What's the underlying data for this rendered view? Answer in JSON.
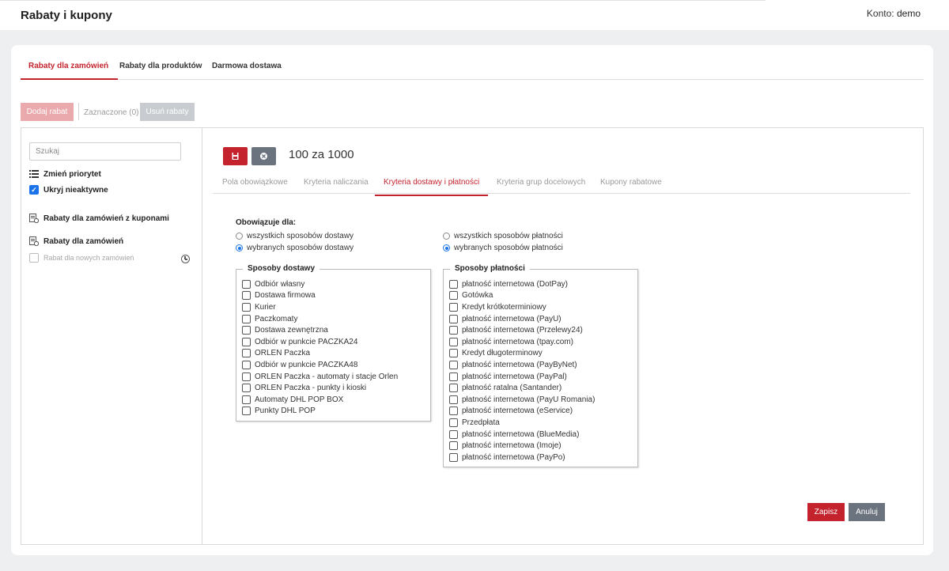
{
  "header": {
    "title": "Rabaty i kupony",
    "account_label": "Konto:",
    "account_name": "demo"
  },
  "main_tabs": [
    {
      "label": "Rabaty dla zamówień",
      "active": true
    },
    {
      "label": "Rabaty dla produktów",
      "active": false
    },
    {
      "label": "Darmowa dostawa",
      "active": false
    }
  ],
  "toolbar": {
    "add_label": "Dodaj rabat",
    "selected_label": "Zaznaczone (0)",
    "delete_label": "Usuń rabaty"
  },
  "sidebar": {
    "search_placeholder": "Szukaj",
    "change_priority": "Zmień priorytet",
    "hide_inactive": "Ukryj nieaktywne",
    "hide_inactive_checked": true,
    "group_coupons": "Rabaty dla zamówień z kuponami",
    "group_orders": "Rabaty dla zamówień",
    "items": [
      {
        "label": "Rabat dla nowych zamówień",
        "checked": false
      }
    ]
  },
  "editor": {
    "title": "100 za 1000",
    "save_icon": "floppy-icon",
    "close_icon": "x-circle-icon",
    "tabs": [
      {
        "label": "Pola obowiązkowe",
        "active": false
      },
      {
        "label": "Kryteria naliczania",
        "active": false
      },
      {
        "label": "Kryteria dostawy i płatności",
        "active": true
      },
      {
        "label": "Kryteria grup docelowych",
        "active": false
      },
      {
        "label": "Kupony rabatowe",
        "active": false
      }
    ],
    "applies_label": "Obowiązuje dla:",
    "shipping_radio": [
      {
        "label": "wszystkich sposobów dostawy",
        "selected": false
      },
      {
        "label": "wybranych sposobów dostawy",
        "selected": true
      }
    ],
    "payment_radio": [
      {
        "label": "wszystkich sposobów płatności",
        "selected": false
      },
      {
        "label": "wybranych sposobów płatności",
        "selected": true
      }
    ],
    "shipping_legend": "Sposoby dostawy",
    "shipping_methods": [
      "Odbiór własny",
      "Dostawa firmowa",
      "Kurier",
      "Paczkomaty",
      "Dostawa zewnętrzna",
      "Odbiór w punkcie PACZKA24",
      "ORLEN Paczka",
      "Odbiór w punkcie PACZKA48",
      "ORLEN Paczka - automaty i stacje Orlen",
      "ORLEN Paczka - punkty i kioski",
      "Automaty DHL POP BOX",
      "Punkty DHL POP"
    ],
    "payment_legend": "Sposoby płatności",
    "payment_methods": [
      "płatność internetowa (DotPay)",
      "Gotówka",
      "Kredyt krótkoterminiowy",
      "płatność internetowa (PayU)",
      "płatność internetowa (Przelewy24)",
      "płatność internetowa (tpay.com)",
      "Kredyt długoterminowy",
      "płatność internetowa (PayByNet)",
      "płatność internetowa (PayPal)",
      "płatność ratalna (Santander)",
      "płatność internetowa (PayU Romania)",
      "płatność internetowa (eService)",
      "Przedpłata",
      "płatność internetowa (BlueMedia)",
      "płatność internetowa (Imoje)",
      "płatność internetowa (PayPo)"
    ],
    "submit_label": "Zapisz",
    "cancel_label": "Anuluj"
  },
  "colors": {
    "accent": "#c4222d",
    "secondary": "#6a737e",
    "checkbox": "#1a73e8"
  }
}
